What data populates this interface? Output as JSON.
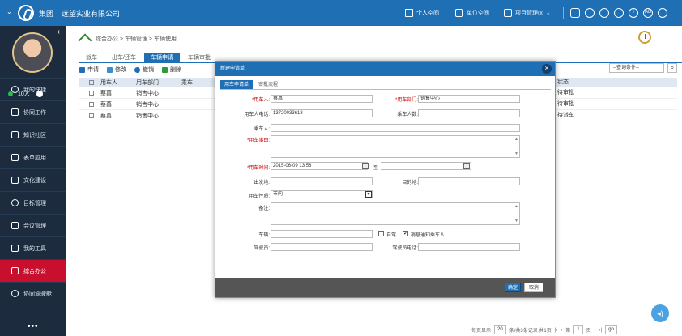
{
  "header": {
    "group_label": "集团",
    "company": "远望实业有限公司",
    "nav": [
      {
        "label": "个人空间",
        "active": true
      },
      {
        "label": "单位空间",
        "active": false
      },
      {
        "label": "项目管理(x",
        "active": false
      }
    ],
    "circle_icons": [
      "AB"
    ]
  },
  "sidebar": {
    "online_count": "10人",
    "items": [
      {
        "label": "我的快捷"
      },
      {
        "label": "协同工作"
      },
      {
        "label": "知识社区"
      },
      {
        "label": "表单应用"
      },
      {
        "label": "文化建设"
      },
      {
        "label": "目标管理"
      },
      {
        "label": "会议管理"
      },
      {
        "label": "我的工具"
      },
      {
        "label": "综合办公",
        "active": true
      },
      {
        "label": "协同驾驶舱"
      }
    ],
    "more": "•••"
  },
  "main": {
    "breadcrumb": "综合办公 > 车辆管理 > 车辆使用",
    "tabs": [
      "派车",
      "出车/还车",
      "车辆申请",
      "车辆审批"
    ],
    "active_tab": "车辆申请",
    "toolbar": {
      "apply": "申请",
      "edit": "修改",
      "withdraw": "撤销",
      "delete": "删除"
    },
    "query_placeholder": "--查询条件--",
    "columns": {
      "user": "用车人",
      "dept": "用车部门",
      "extra": "乘车",
      "status": "状态"
    },
    "rows": [
      {
        "user": "蔡菖",
        "dept": "销售中心",
        "status": "待审批"
      },
      {
        "user": "蔡菖",
        "dept": "销售中心",
        "status": "待审批"
      },
      {
        "user": "蔡菖",
        "dept": "销售中心",
        "status": "待派车"
      }
    ],
    "pager": {
      "per_page_label": "每页显示",
      "per_page": "20",
      "summary": "条/共3条记录 共1页",
      "page_prefix": "第",
      "page": "1",
      "page_suffix": "页",
      "go": "go"
    }
  },
  "dialog": {
    "title": "新建申请单",
    "close": "×",
    "tabs": [
      "用车申请单",
      "审批流程"
    ],
    "fields": {
      "user_label": "*用车人:",
      "user_value": "蔡菖",
      "dept_label": "*用车部门:",
      "dept_value": "销售中心",
      "phone_label": "用车人电话:",
      "phone_value": "13720033618",
      "passengers_label": "乘车人数:",
      "passenger_label": "乘车人:",
      "reason_label": "*用车事由:",
      "time_label": "*用车时间:",
      "time_value": "2015-06-09 13:56",
      "to_label": "至",
      "from_label": "出发地:",
      "dest_label": "目的地:",
      "nature_label": "用车性质:",
      "nature_value": "市内",
      "remark_label": "备注:",
      "vehicle_label": "车辆:",
      "self_drive_label": "自驾",
      "notify_label": "消息通知乘车人",
      "driver_label": "驾驶员:",
      "driver_phone_label": "驾驶员电话:"
    },
    "ok": "确定",
    "cancel": "取消"
  }
}
